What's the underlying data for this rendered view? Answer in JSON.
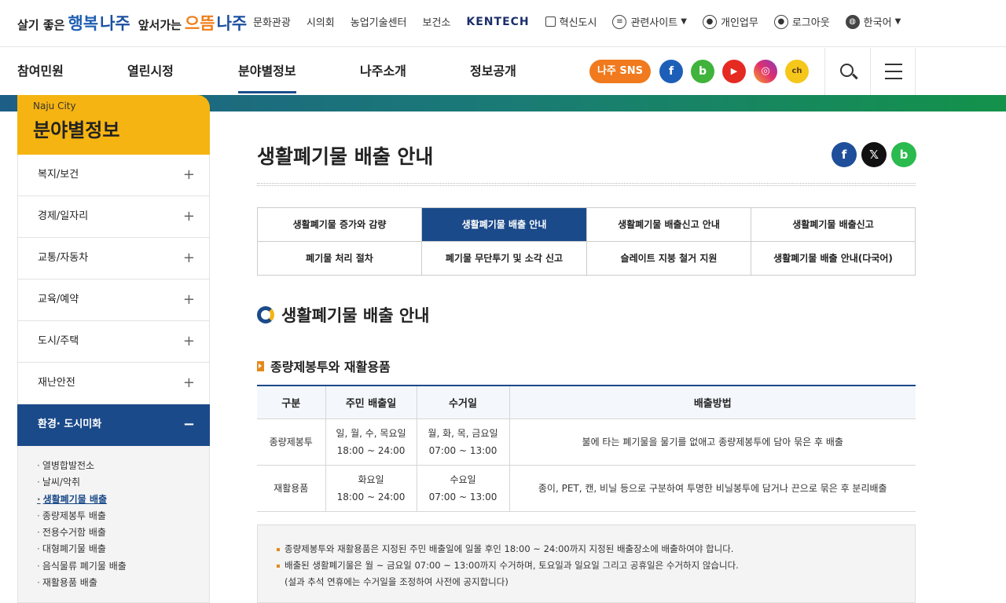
{
  "logo": {
    "part1_small": "살기 좋은",
    "part1_big": "행복",
    "part1_city": "나주",
    "part2_small": "앞서가는",
    "part2_big": "으뜸",
    "part2_city": "나주"
  },
  "utility_links": {
    "culture": "문화관광",
    "council": "시의회",
    "agri": "농업기술센터",
    "health": "보건소",
    "kentech": "KENTECH",
    "innov": "혁신도시",
    "related": "관련사이트",
    "personal": "개인업무",
    "logout": "로그아웃",
    "lang": "한국어"
  },
  "nav": {
    "items": [
      "참여민원",
      "열린시정",
      "분야별정보",
      "나주소개",
      "정보공개"
    ],
    "sns_label": "나주 SNS"
  },
  "sidebar": {
    "subtitle": "Naju City",
    "title": "분야별정보",
    "items": [
      "복지/보건",
      "경제/일자리",
      "교통/자동차",
      "교육/예약",
      "도시/주택",
      "재난안전",
      "환경· 도시미화"
    ],
    "submenu": [
      "열병합발전소",
      "날씨/악취",
      "생활폐기물 배출",
      "종량제봉투 배출",
      "전용수거함 배출",
      "대형폐기물 배출",
      "음식물류 폐기물 배출",
      "재활용품 배출"
    ]
  },
  "content": {
    "page_title": "생활폐기물 배출 안내",
    "tabs": [
      "생활폐기물 증가와 감량",
      "생활폐기물 배출 안내",
      "생활폐기물 배출신고 안내",
      "생활폐기물 배출신고",
      "폐기물 처리 절차",
      "폐기물 무단투기 및 소각 신고",
      "슬레이트 지붕 철거 지원",
      "생활폐기물 배출 안내(다국어)"
    ],
    "section_title": "생활폐기물 배출 안내",
    "subsection_title": "종량제봉투와 재활용품",
    "table": {
      "headers": [
        "구분",
        "주민 배출일",
        "수거일",
        "배출방법"
      ],
      "rows": [
        {
          "type": "종량제봉투",
          "resident_days": "일, 월, 수, 목요일",
          "resident_time": "18:00 ~ 24:00",
          "collect_days": "월, 화, 목, 금요일",
          "collect_time": "07:00 ~ 13:00",
          "method": "불에 타는 폐기물을 물기를 없애고 종량제봉투에 담아 묶은 후 배출"
        },
        {
          "type": "재활용품",
          "resident_days": "화요일",
          "resident_time": "18:00 ~ 24:00",
          "collect_days": "수요일",
          "collect_time": "07:00 ~ 13:00",
          "method": "종이, PET, 캔, 비닐 등으로 구분하여 투명한 비닐봉투에 담거나 끈으로 묶은 후 분리배출"
        }
      ]
    },
    "notes": [
      "종량제봉투와 재활용품은 지정된 주민 배출일에 일몰 후인 18:00 ~ 24:00까지 지정된 배출장소에 배출하여야 합니다.",
      "배출된 생활폐기물은 월 ~ 금요일 07:00 ~ 13:00까지 수거하며, 토요일과 일요일 그리고 공휴일은 수거하지 않습니다.",
      "(설과 추석 연휴에는 수거일을 조정하여 사전에 공지합니다)"
    ]
  },
  "icons": {
    "facebook": "facebook-icon",
    "blog": "blog-icon",
    "youtube": "youtube-icon",
    "instagram": "instagram-icon",
    "kakao": "kakao-channel-icon",
    "x": "x-icon",
    "band": "band-icon",
    "search": "search-icon",
    "menu": "hamburger-menu-icon"
  },
  "colors": {
    "primary": "#1b4a8a",
    "accent": "#f6b412",
    "sns": "#f07a1d"
  }
}
